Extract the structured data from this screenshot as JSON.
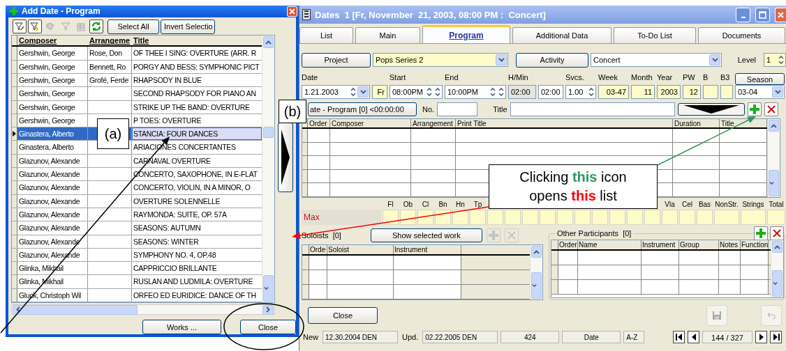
{
  "add_dialog": {
    "title": "Add Date - Program",
    "toolbar_buttons": [
      "Select All",
      "Invert Selectio"
    ],
    "columns": [
      "Composer",
      "Arrangeme",
      "Title"
    ],
    "rows": [
      {
        "composer": "Gershwin, George",
        "arranger": "Rose, Don",
        "title": "OF THEE I SING: OVERTURE (ARR. R",
        "selected": false
      },
      {
        "composer": "Gershwin, George",
        "arranger": "Bennett, Ro",
        "title": "PORGY AND BESS: SYMPHONIC PICT",
        "selected": false
      },
      {
        "composer": "Gershwin, George",
        "arranger": "Grofé, Ferde",
        "title": "RHAPSODY IN BLUE",
        "selected": false
      },
      {
        "composer": "Gershwin, George",
        "title": "SECOND RHAPSODY FOR PIANO AN",
        "selected": false
      },
      {
        "composer": "Gershwin, George",
        "title": "STRIKE UP THE BAND: OVERTURE",
        "selected": false
      },
      {
        "composer": "Gershwin, George",
        "title": "P TOES: OVERTURE",
        "selected": false
      },
      {
        "composer": "Ginastera, Alberto",
        "title": "STANCIA: FOUR DANCES",
        "selected": true
      },
      {
        "composer": "Ginastera, Alberto",
        "title": "ARIACIONES CONCERTANTES",
        "selected": false
      },
      {
        "composer": "Glazunov, Alexande",
        "title": "CARNAVAL OVERTURE",
        "selected": false
      },
      {
        "composer": "Glazunov, Alexande",
        "title": "CONCERTO, SAXOPHONE, IN E-FLAT",
        "selected": false
      },
      {
        "composer": "Glazunov, Alexande",
        "title": "CONCERTO, VIOLIN, IN A MINOR, O",
        "selected": false
      },
      {
        "composer": "Glazunov, Alexande",
        "title": "OVERTURE SOLENNELLE",
        "selected": false
      },
      {
        "composer": "Glazunov, Alexande",
        "title": "RAYMONDA: SUITE, OP. 57A",
        "selected": false
      },
      {
        "composer": "Glazunov, Alexande",
        "title": "SEASONS: AUTUMN",
        "selected": false
      },
      {
        "composer": "Glazunov, Alexande",
        "title": "SEASONS: WINTER",
        "selected": false
      },
      {
        "composer": "Glazunov, Alexande",
        "title": "SYMPHONY NO. 4, OP.48",
        "selected": false
      },
      {
        "composer": "Glinka, Mikhail",
        "title": "CAPPRICCIO BRILLANTE",
        "selected": false
      },
      {
        "composer": "Glinka, Mikhail",
        "title": "RUSLAN AND LUDMILA: OVERTURE",
        "selected": false
      },
      {
        "composer": "Gluck, Christoph Wil",
        "title": "ORFEO ED EURIDICE: DANCE OF TH",
        "selected": false
      }
    ],
    "buttons": [
      "Works ...",
      "Close"
    ]
  },
  "dates_window": {
    "title": "Dates  1 [Fr, November  21, 2003, 08:00 PM :  Concert]",
    "tabs": [
      {
        "label": "List",
        "selected": false
      },
      {
        "label": "Main",
        "selected": false
      },
      {
        "label": "Program",
        "selected": true
      },
      {
        "label": "Additional Data",
        "selected": false
      },
      {
        "label": "To-Do List",
        "selected": false
      },
      {
        "label": "Documents",
        "selected": false
      }
    ],
    "project": {
      "button": "Project",
      "value": "Pops Series 2"
    },
    "activity": {
      "button": "Activity",
      "value": "Concert"
    },
    "level": {
      "label": "Level",
      "value": "1"
    },
    "schedule": [
      {
        "kind": "date",
        "label": "Date",
        "value": "1.21.2003",
        "readonly": false,
        "disabled": false
      },
      {
        "kind": "text",
        "value": "Fr",
        "readonly": true,
        "disabled": false
      },
      {
        "kind": "spin",
        "label": "Start",
        "value": "08:00PM",
        "readonly": false,
        "disabled": false
      },
      {
        "kind": "spin",
        "label": "End",
        "value": "10:00PM",
        "readonly": false,
        "disabled": false
      },
      {
        "kind": "text",
        "label": "H/Min",
        "value": "02:00",
        "readonly": false,
        "disabled": true
      },
      {
        "kind": "text",
        "value": "02:00",
        "readonly": false,
        "disabled": false
      },
      {
        "kind": "spin",
        "label": "Svcs.",
        "value": "1.00",
        "readonly": false,
        "disabled": false
      },
      {
        "kind": "text",
        "label": "Week",
        "value": "03-47",
        "readonly": true,
        "disabled": false
      },
      {
        "kind": "text",
        "label": "Month",
        "value": "11",
        "readonly": true,
        "disabled": false
      },
      {
        "kind": "text",
        "label": "Year",
        "value": "2003",
        "readonly": true,
        "disabled": false
      },
      {
        "kind": "text",
        "label": "PW",
        "value": "12",
        "readonly": true,
        "disabled": false
      },
      {
        "kind": "text",
        "label": "B",
        "readonly": true,
        "disabled": false
      },
      {
        "kind": "text",
        "label": "B3",
        "readonly": true,
        "disabled": false
      }
    ],
    "season": {
      "button": "Season",
      "value": "03-04"
    },
    "program_bar": {
      "button": "ate - Program  [0]   <00:00:00",
      "no_label": "No.",
      "title_label": "Title"
    },
    "program_columns": [
      "Order",
      "Composer",
      "Arrangement",
      "Print Title",
      "Duration",
      "Title"
    ],
    "instruments_left": [
      "Fl",
      "Ob",
      "Cl",
      "Bn",
      "Hn",
      "Tp"
    ],
    "instruments_right": [
      "Vla",
      "Cel",
      "Bas",
      "NonStr.",
      "Strings",
      "Total"
    ],
    "max_label": "Max",
    "soloists": {
      "title": "Soloists  [0]",
      "button": "Show selected work",
      "columns": [
        "Orde",
        "Soloist",
        "Instrument"
      ]
    },
    "participants": {
      "title": "Other Participants  [0]",
      "columns": [
        "Order",
        "Name",
        "Instrument",
        "Group",
        "Notes",
        "Function"
      ]
    },
    "close_button": "Close",
    "status": {
      "new_label": "New",
      "new_value": "12.30.2004 DEN",
      "upd_label": "Upd.",
      "upd_value": "02.22.2005 DEN",
      "count": "424",
      "sort": "Date",
      "order": "A-Z",
      "record": "144 / 327"
    }
  },
  "annotations": {
    "label_a": "(a)",
    "label_b": "(b)",
    "callout": [
      [
        {
          "text": "Clicking "
        },
        {
          "text": "this",
          "color": "#2e9a5c"
        },
        {
          "text": " icon"
        }
      ],
      [
        {
          "text": "opens "
        },
        {
          "text": "this",
          "color": "#ff0000"
        },
        {
          "text": " list"
        }
      ]
    ]
  }
}
